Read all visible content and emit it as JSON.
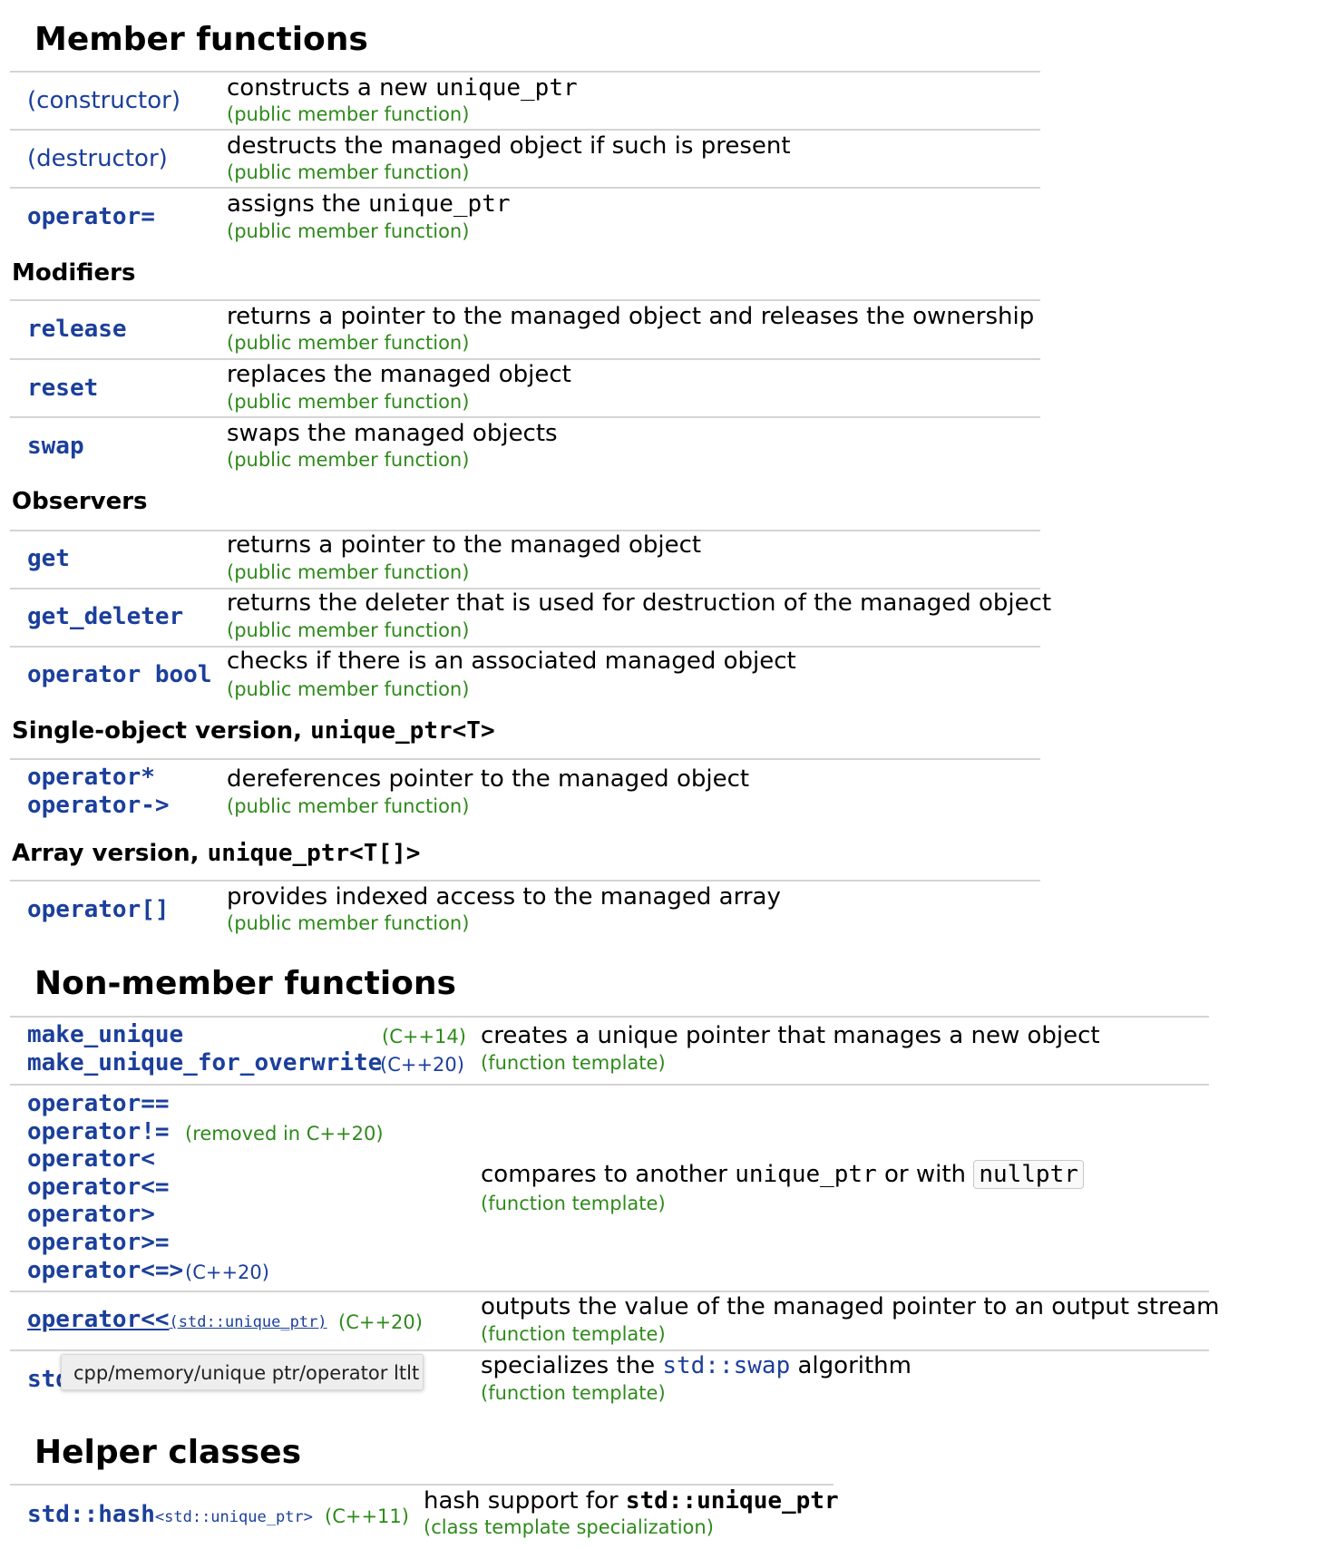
{
  "sections": {
    "member": "Member functions",
    "nonmember": "Non-member functions",
    "helper": "Helper classes"
  },
  "member": {
    "constructor": {
      "link": "(constructor)",
      "desc": "constructs a new ",
      "code": "unique_ptr",
      "kind": "(public member function)"
    },
    "destructor": {
      "link": "(destructor)",
      "desc": "destructs the managed object if such is present",
      "kind": "(public member function)"
    },
    "assign": {
      "link": "operator=",
      "desc": "assigns the ",
      "code": "unique_ptr",
      "kind": "(public member function)"
    }
  },
  "modifiers": {
    "heading": "Modifiers",
    "release": {
      "link": "release",
      "desc": "returns a pointer to the managed object and releases the ownership",
      "kind": "(public member function)"
    },
    "reset": {
      "link": "reset",
      "desc": "replaces the managed object",
      "kind": "(public member function)"
    },
    "swap": {
      "link": "swap",
      "desc": "swaps the managed objects",
      "kind": "(public member function)"
    }
  },
  "observers": {
    "heading": "Observers",
    "get": {
      "link": "get",
      "desc": "returns a pointer to the managed object",
      "kind": "(public member function)"
    },
    "get_deleter": {
      "link": "get_deleter",
      "desc": "returns the deleter that is used for destruction of the managed object",
      "kind": "(public member function)"
    },
    "bool": {
      "link": "operator bool",
      "desc": "checks if there is an associated managed object",
      "kind": "(public member function)"
    }
  },
  "single": {
    "heading": "Single-object version, ",
    "heading_code": "unique_ptr<T>",
    "link1": "operator*",
    "link2": "operator->",
    "desc": "dereferences pointer to the managed object",
    "kind": "(public member function)"
  },
  "array": {
    "heading": "Array version, ",
    "heading_code": "unique_ptr<T[]>",
    "link": "operator[]",
    "desc": "provides indexed access to the managed array",
    "kind": "(public member function)"
  },
  "nonmember": {
    "make": {
      "link1": "make_unique",
      "ver1": "(C++14)",
      "link2": "make_unique_for_overwrite",
      "ver2": "(C++20)",
      "desc": "creates a unique pointer that manages a new object",
      "kind": "(function template)"
    },
    "compare": {
      "ops": [
        "operator==",
        "operator!=",
        "operator<",
        "operator<=",
        "operator>",
        "operator>=",
        "operator<=>"
      ],
      "removed": "(removed in C++20)",
      "ver_last": "(C++20)",
      "desc_a": "compares to another ",
      "desc_code": "unique_ptr",
      "desc_b": " or with ",
      "desc_null": "nullptr",
      "kind": "(function template)"
    },
    "stream": {
      "link": "operator<<",
      "suffix": "(std::unique_ptr)",
      "ver": "(C++20)",
      "desc": "outputs the value of the managed pointer to an output stream",
      "kind": "(function template)"
    },
    "swap": {
      "link_prefix": "std",
      "desc_a": "specializes the ",
      "desc_code": "std::swap",
      "desc_b": " algorithm",
      "kind": "(function template)"
    }
  },
  "tooltip": "cpp/memory/unique ptr/operator ltlt",
  "helper": {
    "link": "std::hash",
    "suffix": "<std::unique_ptr>",
    "ver": "(C++11)",
    "desc": "hash support for ",
    "desc_code": "std::unique_ptr",
    "kind": "(class template specialization)"
  }
}
